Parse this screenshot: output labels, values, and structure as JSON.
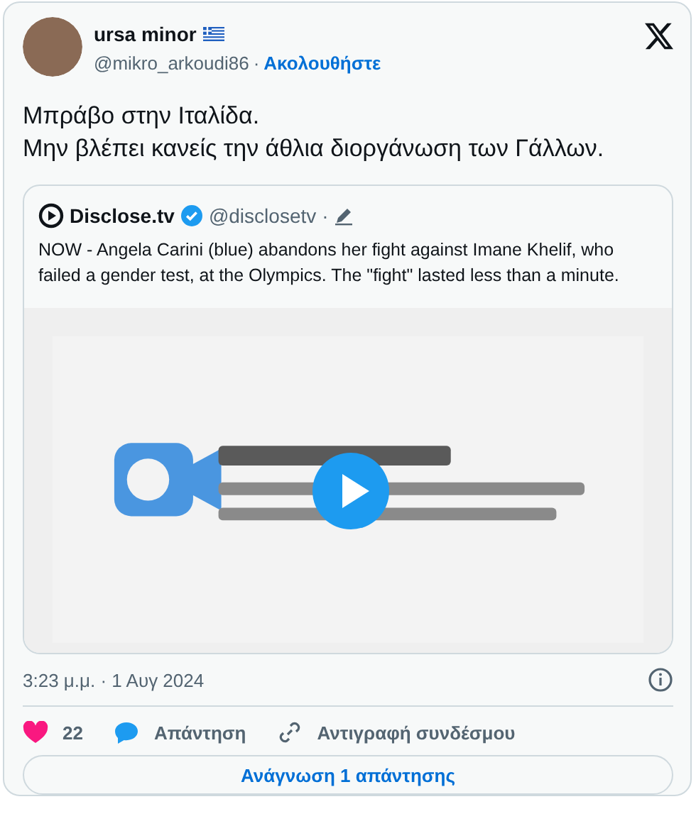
{
  "author": {
    "name": "ursa minor",
    "handle": "@mikro_arkoudi86",
    "separator": "·",
    "follow": "Ακολουθήστε"
  },
  "text": [
    "Μπράβο στην Ιταλίδα.",
    "Μην βλέπει κανείς την άθλια διοργάνωση των Γάλλων."
  ],
  "quote": {
    "name": "Disclose.tv",
    "verified": true,
    "handle": "@disclosetv",
    "separator": "·",
    "text": "NOW - Angela Carini (blue) abandons her fight against Imane Khelif, who failed a gender test, at the Olympics. The \"fight\" lasted less than a minute."
  },
  "timestamp": "3:23 μ.μ. · 1 Αυγ 2024",
  "actions": [
    {
      "kind": "like",
      "label": "22"
    },
    {
      "kind": "reply",
      "label": "Απάντηση"
    },
    {
      "kind": "copy",
      "label": "Αντιγραφή συνδέσμου"
    }
  ],
  "read_replies": "Ανάγνωση 1 απάντησης"
}
